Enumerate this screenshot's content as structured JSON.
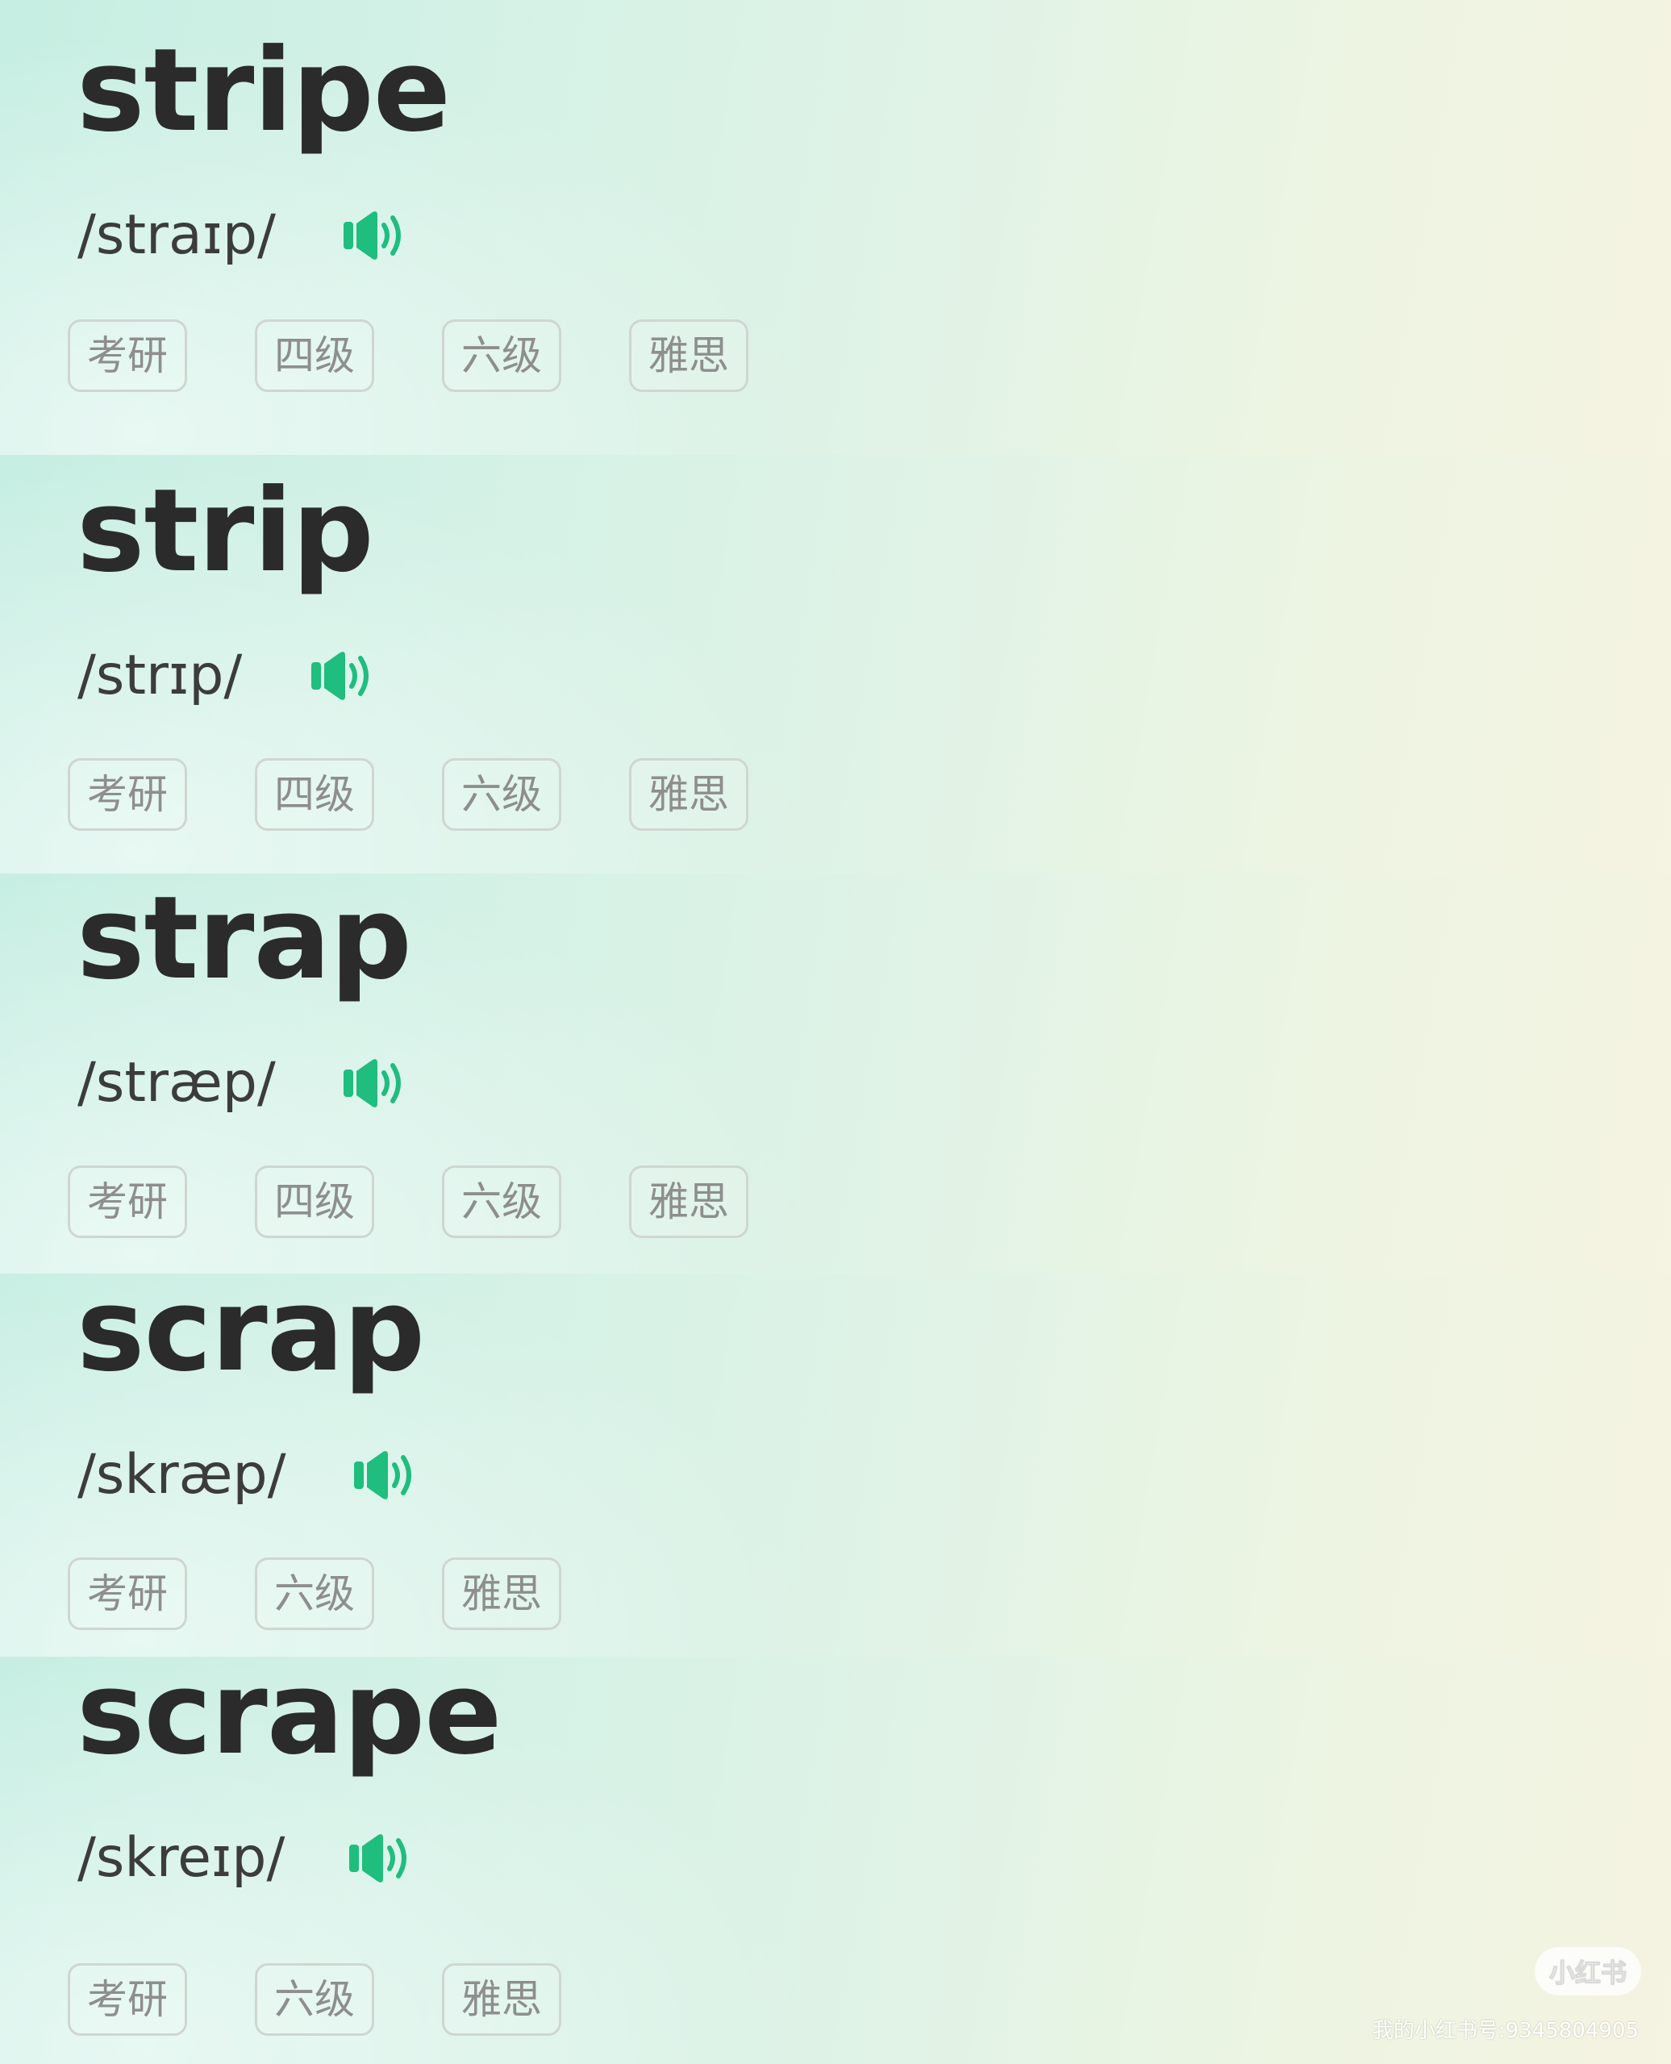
{
  "words": [
    {
      "word": "stripe",
      "phonetic": "/straɪp/",
      "audio_icon": "speaker-icon",
      "tags": [
        "考研",
        "四级",
        "六级",
        "雅思"
      ]
    },
    {
      "word": "strip",
      "phonetic": "/strɪp/",
      "audio_icon": "speaker-icon",
      "tags": [
        "考研",
        "四级",
        "六级",
        "雅思"
      ]
    },
    {
      "word": "strap",
      "phonetic": "/stræp/",
      "audio_icon": "speaker-icon",
      "tags": [
        "考研",
        "四级",
        "六级",
        "雅思"
      ]
    },
    {
      "word": "scrap",
      "phonetic": "/skræp/",
      "audio_icon": "speaker-icon",
      "tags": [
        "考研",
        "六级",
        "雅思"
      ]
    },
    {
      "word": "scrape",
      "phonetic": "/skreɪp/",
      "audio_icon": "speaker-icon",
      "tags": [
        "考研",
        "六级",
        "雅思"
      ]
    }
  ],
  "colors": {
    "accent_green": "#1fbd7e",
    "word_text": "#2b2b2b",
    "tag_text": "#8e8e8e"
  },
  "watermark": {
    "logo": "小红书",
    "id_text": "我的小红书号:9345804905"
  }
}
